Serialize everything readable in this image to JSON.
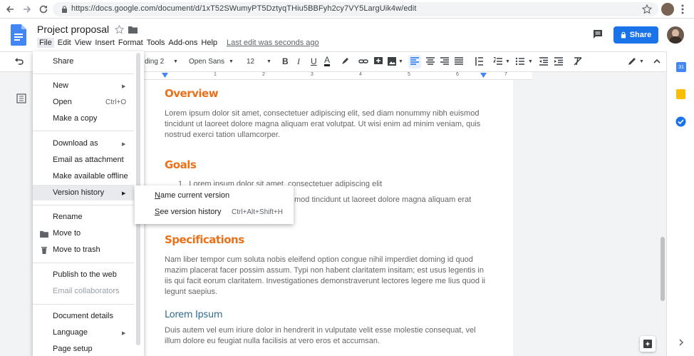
{
  "browser": {
    "url": "https://docs.google.com/document/d/1xT52SWumyPT5DztyqTHiu5BBFyh2cy7VY5LargUik4w/edit"
  },
  "doc": {
    "title": "Project proposal",
    "menus": [
      "File",
      "Edit",
      "View",
      "Insert",
      "Format",
      "Tools",
      "Add-ons",
      "Help"
    ],
    "last_edit": "Last edit was seconds ago",
    "share_label": "Share"
  },
  "toolbar": {
    "style": "ding 2",
    "font": "Open Sans",
    "size": "12"
  },
  "ruler_marks": [
    "1",
    "2",
    "3",
    "4",
    "5",
    "6",
    "7"
  ],
  "file_menu": {
    "share": "Share",
    "new": "New",
    "open": "Open",
    "open_shortcut": "Ctrl+O",
    "make_copy": "Make a copy",
    "download_as": "Download as",
    "email_attachment": "Email as attachment",
    "make_offline": "Make available offline",
    "version_history": "Version history",
    "rename": "Rename",
    "move_to": "Move to",
    "move_trash": "Move to trash",
    "publish": "Publish to the web",
    "email_collab": "Email collaborators",
    "doc_details": "Document details",
    "language": "Language",
    "page_setup": "Page setup"
  },
  "submenu": {
    "name_version_u": "N",
    "name_version_rest": "ame current version",
    "see_history_u": "S",
    "see_history_rest": "ee version history",
    "see_history_shortcut": "Ctrl+Alt+Shift+H"
  },
  "content": {
    "overview_heading": "Overview",
    "overview_text": "Lorem ipsum dolor sit amet, consectetuer adipiscing elit, sed diam nonummy nibh euismod tincidunt ut laoreet dolore magna aliquam erat volutpat. Ut wisi enim ad minim veniam, quis nostrud exerci tation ullamcorper.",
    "goals_heading": "Goals",
    "goals_item1": "Lorem ipsum dolor sit amet, consectetuer adipiscing elit",
    "goals_item2_tail": "mod tincidunt ut laoreet dolore magna aliquam erat",
    "spec_heading": "Specifications",
    "spec_text": "Nam liber tempor cum soluta nobis eleifend option congue nihil imperdiet doming id quod mazim placerat facer possim assum. Typi non habent claritatem insitam; est usus legentis in iis qui facit eorum claritatem. Investigationes demonstraverunt lectores legere me lius quod ii legunt saepius.",
    "lorem_heading": "Lorem Ipsum",
    "lorem_text": "Duis autem vel eum iriure dolor in hendrerit in vulputate velit esse molestie consequat, vel illum dolore eu feugiat nulla facilisis at vero eros et accumsan."
  },
  "colors": {
    "accent": "#1a73e8",
    "heading": "#e8711a",
    "subheading": "#2c6b8e",
    "docs_blue": "#4285f4"
  }
}
